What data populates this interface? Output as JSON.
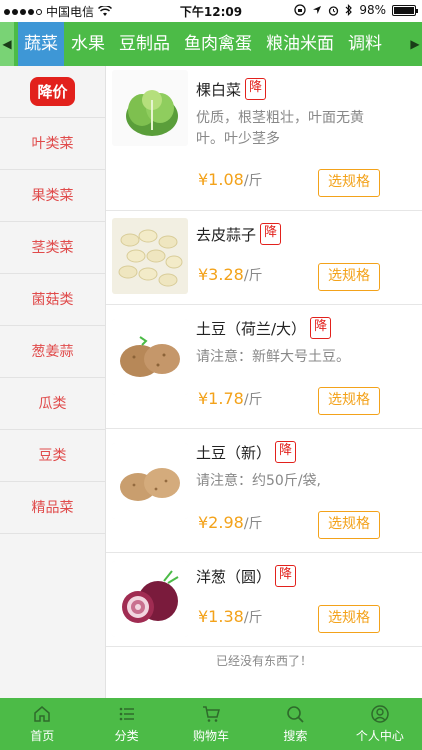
{
  "status_bar": {
    "carrier": "中国电信",
    "time": "下午12:09",
    "battery": "98%",
    "battery_level": 0.98
  },
  "top_nav": {
    "tabs": [
      {
        "label": "蔬菜",
        "active": true
      },
      {
        "label": "水果"
      },
      {
        "label": "豆制品"
      },
      {
        "label": "鱼肉禽蛋"
      },
      {
        "label": "粮油米面"
      },
      {
        "label": "调料"
      }
    ]
  },
  "sidebar": {
    "promo_label": "降价",
    "items": [
      "叶类菜",
      "果类菜",
      "茎类菜",
      "菌菇类",
      "葱姜蒜",
      "瓜类",
      "豆类",
      "精品菜"
    ]
  },
  "products": [
    {
      "name": "棵白菜",
      "badge": "降",
      "desc": "优质，根茎粗壮，叶面无黄叶。叶少茎多",
      "price": "¥1.08",
      "unit": "/斤",
      "button": "选规格"
    },
    {
      "name": "去皮蒜子",
      "badge": "降",
      "desc": "",
      "price": "¥3.28",
      "unit": "/斤",
      "button": "选规格"
    },
    {
      "name": "土豆（荷兰/大）",
      "badge": "降",
      "desc": "请注意：新鲜大号土豆。",
      "price": "¥1.78",
      "unit": "/斤",
      "button": "选规格"
    },
    {
      "name": "土豆（新）",
      "badge": "降",
      "desc": "请注意：约50斤/袋,",
      "price": "¥2.98",
      "unit": "/斤",
      "button": "选规格"
    },
    {
      "name": "洋葱（圆）",
      "badge": "降",
      "desc": "",
      "price": "¥1.38",
      "unit": "/斤",
      "button": "选规格"
    }
  ],
  "list_footer": "已经没有东西了！",
  "bottom_nav": {
    "items": [
      {
        "label": "首页",
        "icon": "home-icon"
      },
      {
        "label": "分类",
        "icon": "list-icon"
      },
      {
        "label": "购物车",
        "icon": "cart-icon"
      },
      {
        "label": "搜索",
        "icon": "search-icon"
      },
      {
        "label": "个人中心",
        "icon": "user-icon"
      }
    ]
  },
  "colors": {
    "primary_green": "#4cbb47",
    "active_tab_blue": "#3e97d6",
    "price_orange": "#f3a21a",
    "badge_red": "#e2211c"
  }
}
